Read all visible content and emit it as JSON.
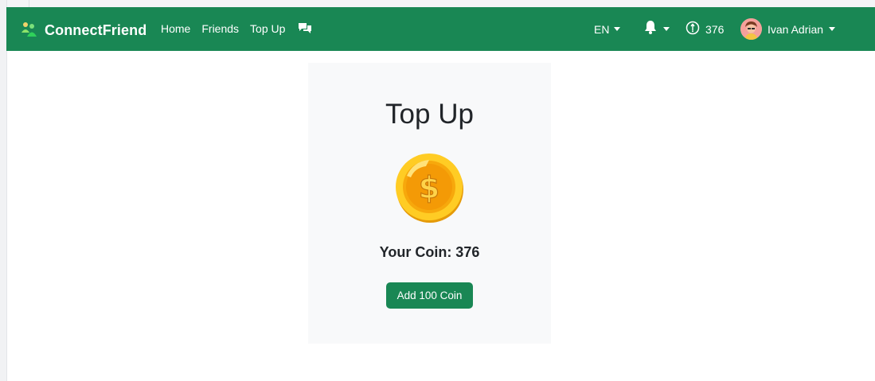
{
  "navbar": {
    "brand": "ConnectFriend",
    "links": [
      {
        "label": "Home"
      },
      {
        "label": "Friends"
      },
      {
        "label": "Top Up"
      }
    ],
    "language": "EN",
    "coin_count": "376",
    "user_name": "Ivan Adrian",
    "icons": {
      "brand": "people-logo-icon",
      "chat": "chat-icon",
      "bell": "bell-icon",
      "coin": "coin-outline-icon",
      "avatar": "user-avatar"
    }
  },
  "main": {
    "title": "Top Up",
    "coin_label": "Your Coin: 376",
    "add_button": "Add 100 Coin"
  },
  "colors": {
    "primary": "#198754",
    "card_bg": "#f8f9fa",
    "coin_gold": "#f7b500"
  }
}
